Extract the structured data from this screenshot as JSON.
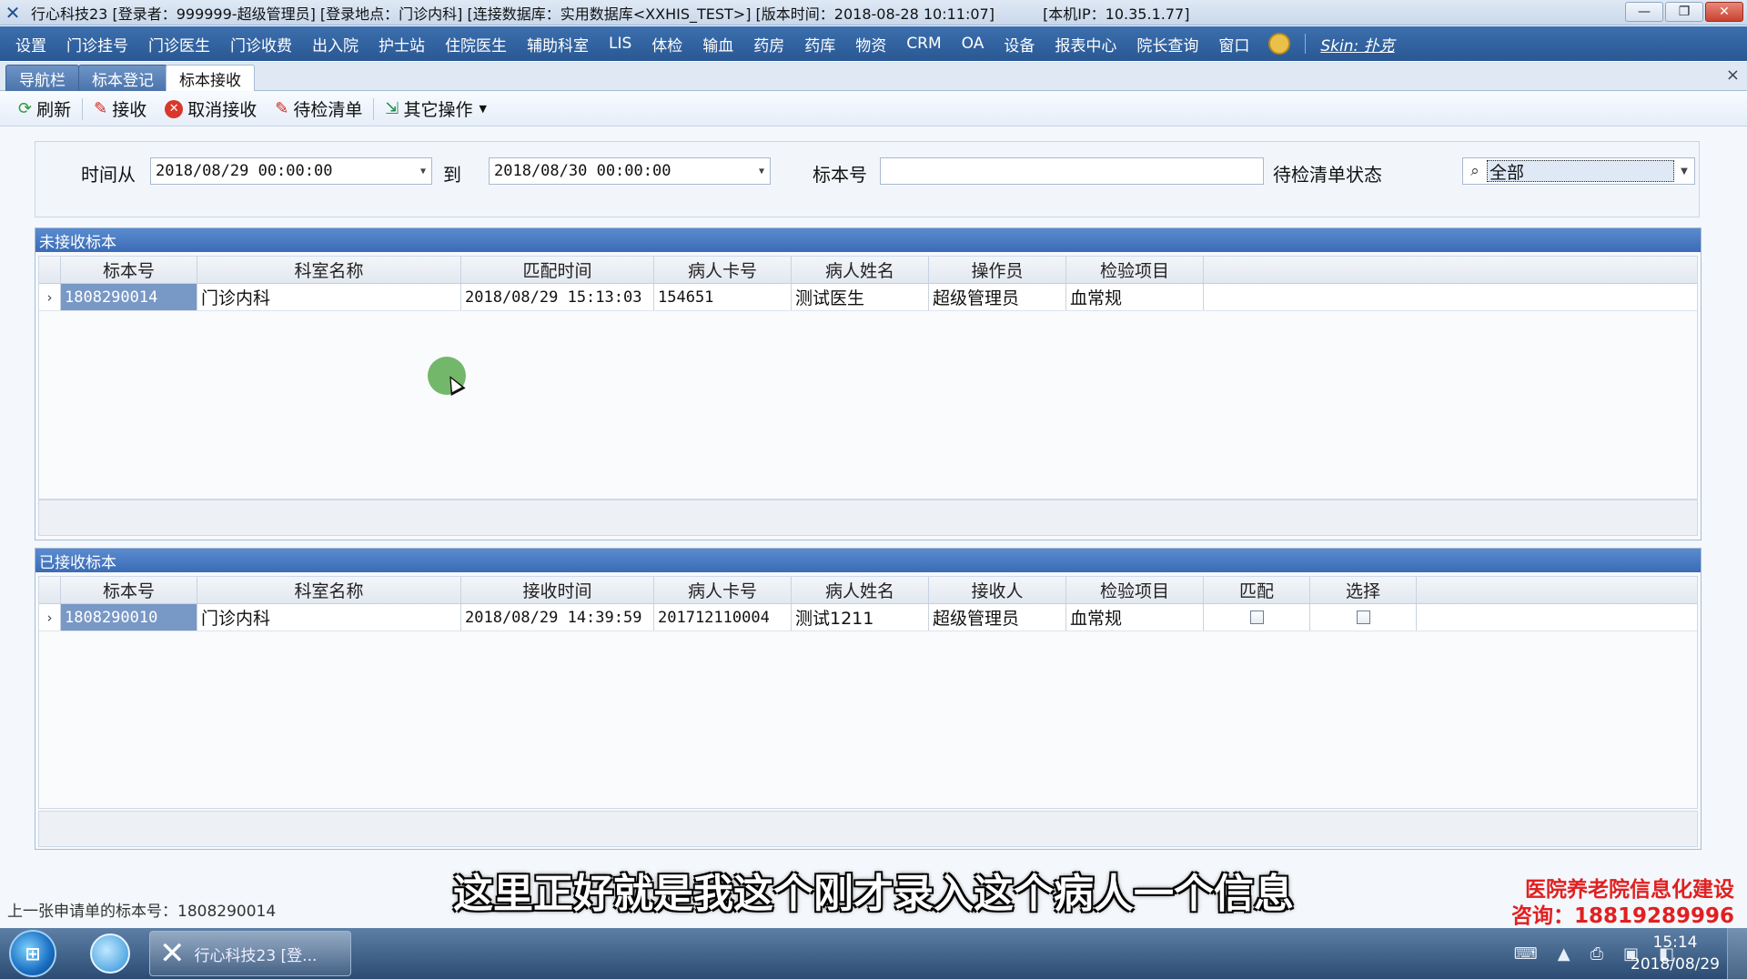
{
  "window": {
    "title_main": "行心科技23",
    "title_user": "[登录者：999999-超级管理员]",
    "title_location": "[登录地点：门诊内科]",
    "title_db": "[连接数据库：实用数据库<XXHIS_TEST>]",
    "title_version": "[版本时间：2018-08-28 10:11:07]",
    "title_ip": "[本机IP：10.35.1.77]",
    "minimize_glyph": "—",
    "restore_glyph": "❐",
    "close_glyph": "✕"
  },
  "menu": {
    "items": [
      "设置",
      "门诊挂号",
      "门诊医生",
      "门诊收费",
      "出入院",
      "护士站",
      "住院医生",
      "辅助科室",
      "LIS",
      "体检",
      "输血",
      "药房",
      "药库",
      "物资",
      "CRM",
      "OA",
      "设备",
      "报表中心",
      "院长查询",
      "窗口"
    ],
    "skin": "Skin: 扑克"
  },
  "tabs": {
    "items": [
      "导航栏",
      "标本登记",
      "标本接收"
    ],
    "active": "标本接收",
    "close_glyph": "×"
  },
  "toolbar": {
    "refresh": "刷新",
    "receive": "接收",
    "cancel_receive": "取消接收",
    "pending_list": "待检清单",
    "other_ops": "其它操作"
  },
  "filter": {
    "time_from_label": "时间从",
    "time_from": "2018/08/29 00:00:00",
    "to_label": "到",
    "time_to": "2018/08/30 00:00:00",
    "specimen_no_label": "标本号",
    "specimen_no_value": "",
    "status_label": "待检清单状态",
    "status_value": "全部"
  },
  "unreceived": {
    "title": "未接收标本",
    "columns": [
      "标本号",
      "科室名称",
      "匹配时间",
      "病人卡号",
      "病人姓名",
      "操作员",
      "检验项目"
    ],
    "rows": [
      {
        "specimen_no": "1808290014",
        "dept": "门诊内科",
        "match_time": "2018/08/29 15:13:03",
        "card_no": "154651",
        "patient": "测试医生",
        "operator": "超级管理员",
        "item": "血常规"
      }
    ]
  },
  "received": {
    "title": "已接收标本",
    "columns": [
      "标本号",
      "科室名称",
      "接收时间",
      "病人卡号",
      "病人姓名",
      "接收人",
      "检验项目",
      "匹配",
      "选择"
    ],
    "rows": [
      {
        "specimen_no": "1808290010",
        "dept": "门诊内科",
        "receive_time": "2018/08/29 14:39:59",
        "card_no": "201712110004",
        "patient": "测试1211",
        "receiver": "超级管理员",
        "item": "血常规",
        "matched": false,
        "selected": false
      }
    ]
  },
  "statusbar": {
    "text": "上一张申请单的标本号：1808290014"
  },
  "subtitle": "这里正好就是我这个刚才录入这个病人一个信息",
  "watermark": {
    "line1": "医院养老院信息化建设",
    "line2": "咨询：18819289996"
  },
  "taskbar": {
    "task_label": "行心科技23 [登...",
    "time": "15:14",
    "date": "2018/08/29"
  },
  "colors": {
    "menubar": "#2f62a3",
    "panel_header": "#3a6cb6",
    "selected_cell": "#7898c6",
    "watermark": "#e02020"
  }
}
